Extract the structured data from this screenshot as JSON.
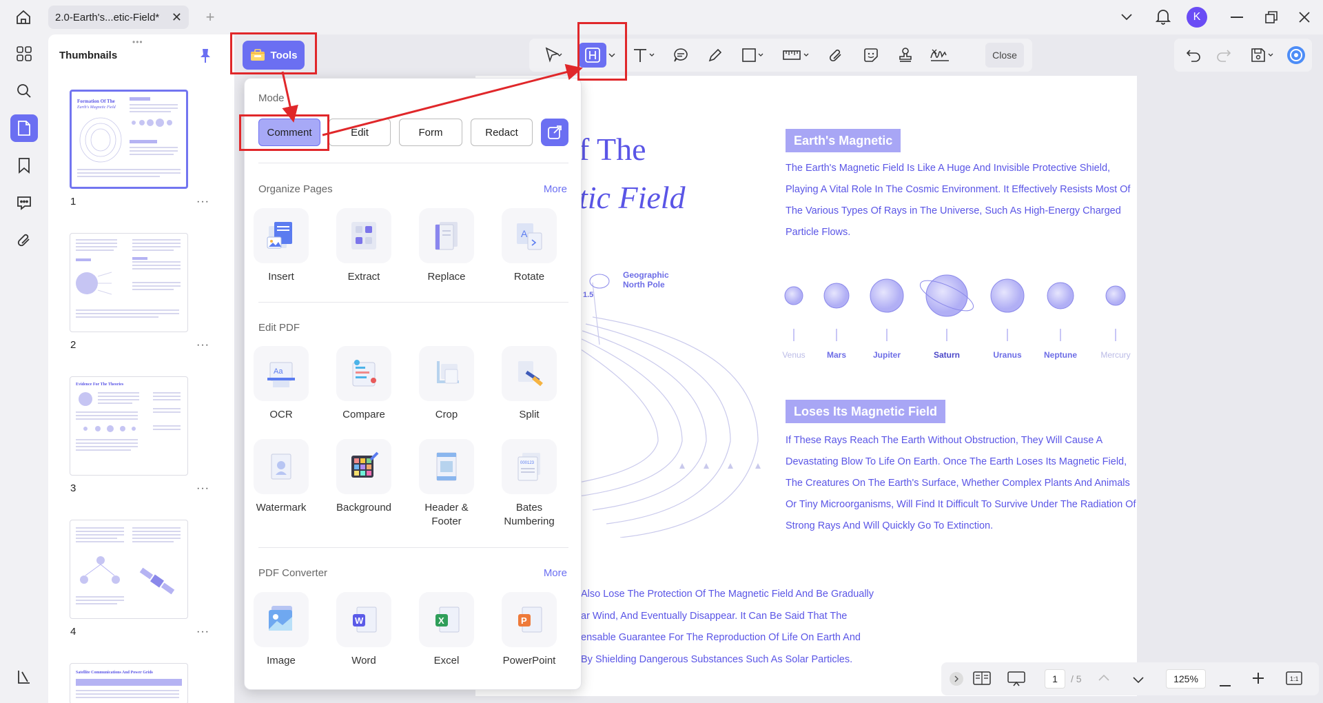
{
  "titlebar": {
    "tab_title": "2.0-Earth's...etic-Field*",
    "avatar_letter": "K"
  },
  "sidebar": {
    "panel_title": "Thumbnails",
    "thumbnails": [
      {
        "page": "1",
        "heading": "Formation Of The",
        "subheading": "Earth's Magnetic Field"
      },
      {
        "page": "2"
      },
      {
        "page": "3",
        "heading": "Evidence For The Theories"
      },
      {
        "page": "4"
      },
      {
        "heading": "Satellite Communications And Power Grids"
      }
    ],
    "more_glyph": "···"
  },
  "toolbar": {
    "tools_label": "Tools",
    "close_label": "Close"
  },
  "dropdown": {
    "mode_label": "Mode",
    "modes": [
      "Comment",
      "Edit",
      "Form",
      "Redact"
    ],
    "organize_label": "Organize Pages",
    "organize_more": "More",
    "organize_tools": [
      "Insert",
      "Extract",
      "Replace",
      "Rotate"
    ],
    "edit_label": "Edit PDF",
    "edit_tools": [
      "OCR",
      "Compare",
      "Crop",
      "Split",
      "Watermark",
      "Background",
      "Header & Footer",
      "Bates Numbering"
    ],
    "converter_label": "PDF Converter",
    "converter_more": "More",
    "converter_tools": [
      "Image",
      "Word",
      "Excel",
      "PowerPoint"
    ]
  },
  "document": {
    "title_line1": "f The",
    "title_line2": "tic Field",
    "diagram_label_line1": "Geographic",
    "diagram_label_line2": "North Pole",
    "diagram_number": "1.5",
    "section1_heading": "Earth's Magnetic",
    "section1_body": "The Earth's Magnetic Field Is Like A Huge And Invisible Protective Shield, Playing A Vital Role In The Cosmic Environment. It Effectively Resists Most Of The Various Types Of Rays in The Universe, Such As High-Energy Charged Particle Flows.",
    "planets": [
      "Venus",
      "Mars",
      "Jupiter",
      "Saturn",
      "Uranus",
      "Neptune",
      "Mercury"
    ],
    "section2_heading": "Loses Its Magnetic Field",
    "section2_body": "If These Rays Reach The Earth Without Obstruction, They Will Cause A Devastating Blow To Life On Earth. Once The Earth Loses Its Magnetic Field, The Creatures On The Earth's Surface, Whether Complex Plants And Animals Or Tiny Microorganisms, Will Find It Difficult To Survive Under The Radiation Of Strong Rays And Will Quickly Go To Extinction.",
    "bottom_lines": [
      "Also Lose The Protection Of The Magnetic Field And Be Gradually",
      "ar Wind, And Eventually Disappear. It Can Be Said That The",
      "ensable Guarantee For The Reproduction Of Life On Earth And",
      "By Shielding Dangerous Substances Such As Solar Particles."
    ]
  },
  "statusbar": {
    "current_page": "1",
    "total_pages": "/ 5",
    "zoom": "125%"
  },
  "colors": {
    "accent": "#6b6ff2",
    "annotation_red": "#e0272a",
    "doc_text": "#5a55e6"
  }
}
